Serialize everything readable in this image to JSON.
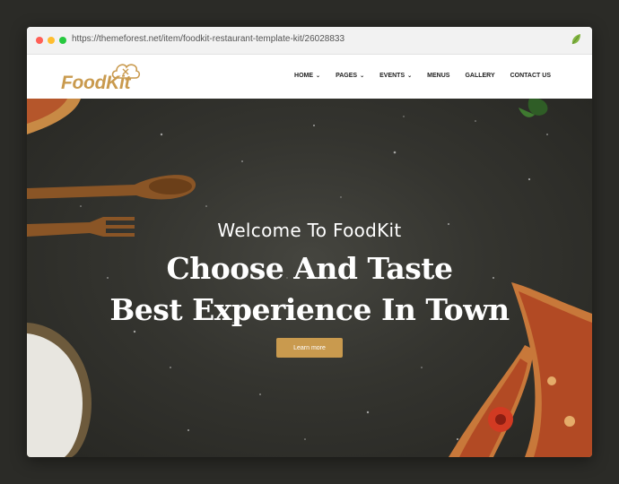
{
  "browser": {
    "url": "https://themeforest.net/item/foodkit-restaurant-template-kit/26028833"
  },
  "site": {
    "logo_text": "FoodKit",
    "brand_color": "#c99a4e",
    "nav": [
      {
        "label": "HOME",
        "has_dropdown": true
      },
      {
        "label": "PAGES",
        "has_dropdown": true
      },
      {
        "label": "EVENTS",
        "has_dropdown": true
      },
      {
        "label": "MENUS",
        "has_dropdown": false
      },
      {
        "label": "GALLERY",
        "has_dropdown": false
      },
      {
        "label": "CONTACT US",
        "has_dropdown": false
      }
    ],
    "caret_glyph": "⌄"
  },
  "hero": {
    "welcome": "Welcome To FoodKit",
    "headline_line1": "Choose And Taste",
    "headline_line2": "Best Experience In Town",
    "button_label": "Learn more"
  }
}
